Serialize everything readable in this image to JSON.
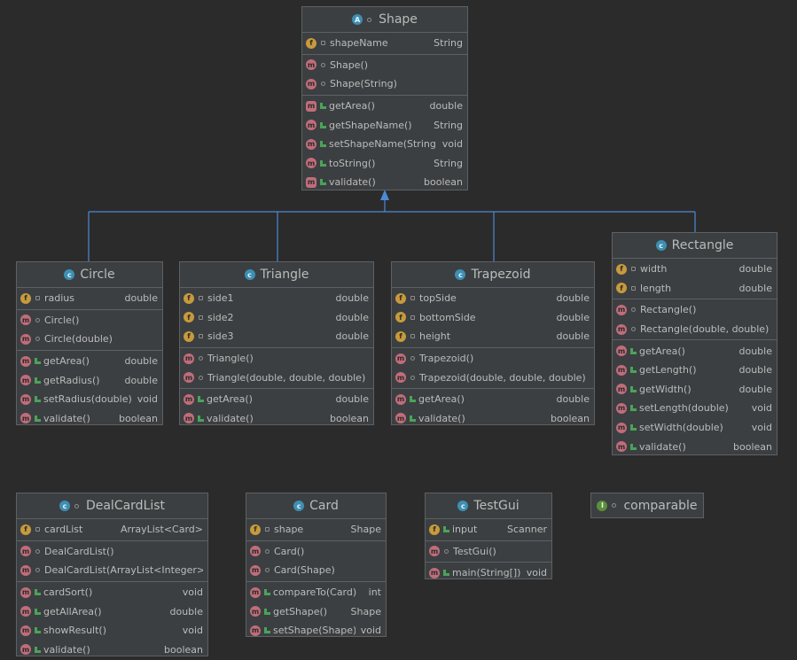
{
  "colors": {
    "background": "#2b2b2b",
    "node": "#3c3f41",
    "border": "#5e6163",
    "connector": "#4b8ad4",
    "text": "#bbbbbb"
  },
  "nodes": {
    "shape": {
      "title": "Shape",
      "kind": "abstract-class",
      "fields": [
        {
          "name": "shapeName",
          "type": "String"
        }
      ],
      "constructors": [
        {
          "name": "Shape()"
        },
        {
          "name": "Shape(String)"
        }
      ],
      "methods": [
        {
          "name": "getArea()",
          "type": "double",
          "abstract": true
        },
        {
          "name": "getShapeName()",
          "type": "String"
        },
        {
          "name": "setShapeName(String)",
          "type": "void"
        },
        {
          "name": "toString()",
          "type": "String"
        },
        {
          "name": "validate()",
          "type": "boolean",
          "abstract": true
        }
      ]
    },
    "circle": {
      "title": "Circle",
      "kind": "class",
      "fields": [
        {
          "name": "radius",
          "type": "double"
        }
      ],
      "constructors": [
        {
          "name": "Circle()"
        },
        {
          "name": "Circle(double)"
        }
      ],
      "methods": [
        {
          "name": "getArea()",
          "type": "double"
        },
        {
          "name": "getRadius()",
          "type": "double"
        },
        {
          "name": "setRadius(double)",
          "type": "void"
        },
        {
          "name": "validate()",
          "type": "boolean"
        }
      ]
    },
    "triangle": {
      "title": "Triangle",
      "kind": "class",
      "fields": [
        {
          "name": "side1",
          "type": "double"
        },
        {
          "name": "side2",
          "type": "double"
        },
        {
          "name": "side3",
          "type": "double"
        }
      ],
      "constructors": [
        {
          "name": "Triangle()"
        },
        {
          "name": "Triangle(double, double, double)"
        }
      ],
      "methods": [
        {
          "name": "getArea()",
          "type": "double"
        },
        {
          "name": "validate()",
          "type": "boolean"
        }
      ]
    },
    "trapezoid": {
      "title": "Trapezoid",
      "kind": "class",
      "fields": [
        {
          "name": "topSide",
          "type": "double"
        },
        {
          "name": "bottomSide",
          "type": "double"
        },
        {
          "name": "height",
          "type": "double"
        }
      ],
      "constructors": [
        {
          "name": "Trapezoid()"
        },
        {
          "name": "Trapezoid(double, double, double)"
        }
      ],
      "methods": [
        {
          "name": "getArea()",
          "type": "double"
        },
        {
          "name": "validate()",
          "type": "boolean"
        }
      ]
    },
    "rectangle": {
      "title": "Rectangle",
      "kind": "class",
      "fields": [
        {
          "name": "width",
          "type": "double"
        },
        {
          "name": "length",
          "type": "double"
        }
      ],
      "constructors": [
        {
          "name": "Rectangle()"
        },
        {
          "name": "Rectangle(double, double)"
        }
      ],
      "methods": [
        {
          "name": "getArea()",
          "type": "double"
        },
        {
          "name": "getLength()",
          "type": "double"
        },
        {
          "name": "getWidth()",
          "type": "double"
        },
        {
          "name": "setLength(double)",
          "type": "void"
        },
        {
          "name": "setWidth(double)",
          "type": "void"
        },
        {
          "name": "validate()",
          "type": "boolean"
        }
      ]
    },
    "dealCardList": {
      "title": "DealCardList",
      "kind": "class",
      "fields": [
        {
          "name": "cardList",
          "type": "ArrayList<Card>"
        }
      ],
      "constructors": [
        {
          "name": "DealCardList()"
        },
        {
          "name": "DealCardList(ArrayList<Integer>)"
        }
      ],
      "methods": [
        {
          "name": "cardSort()",
          "type": "void"
        },
        {
          "name": "getAllArea()",
          "type": "double"
        },
        {
          "name": "showResult()",
          "type": "void"
        },
        {
          "name": "validate()",
          "type": "boolean"
        }
      ]
    },
    "card": {
      "title": "Card",
      "kind": "class",
      "fields": [
        {
          "name": "shape",
          "type": "Shape"
        }
      ],
      "constructors": [
        {
          "name": "Card()"
        },
        {
          "name": "Card(Shape)"
        }
      ],
      "methods": [
        {
          "name": "compareTo(Card)",
          "type": "int"
        },
        {
          "name": "getShape()",
          "type": "Shape"
        },
        {
          "name": "setShape(Shape)",
          "type": "void"
        }
      ]
    },
    "testGui": {
      "title": "TestGui",
      "kind": "class",
      "fields": [
        {
          "name": "input",
          "type": "Scanner"
        }
      ],
      "constructors": [
        {
          "name": "TestGui()"
        }
      ],
      "methods": [
        {
          "name": "main(String[])",
          "type": "void"
        }
      ]
    },
    "comparable": {
      "title": "comparable",
      "kind": "interface"
    }
  }
}
